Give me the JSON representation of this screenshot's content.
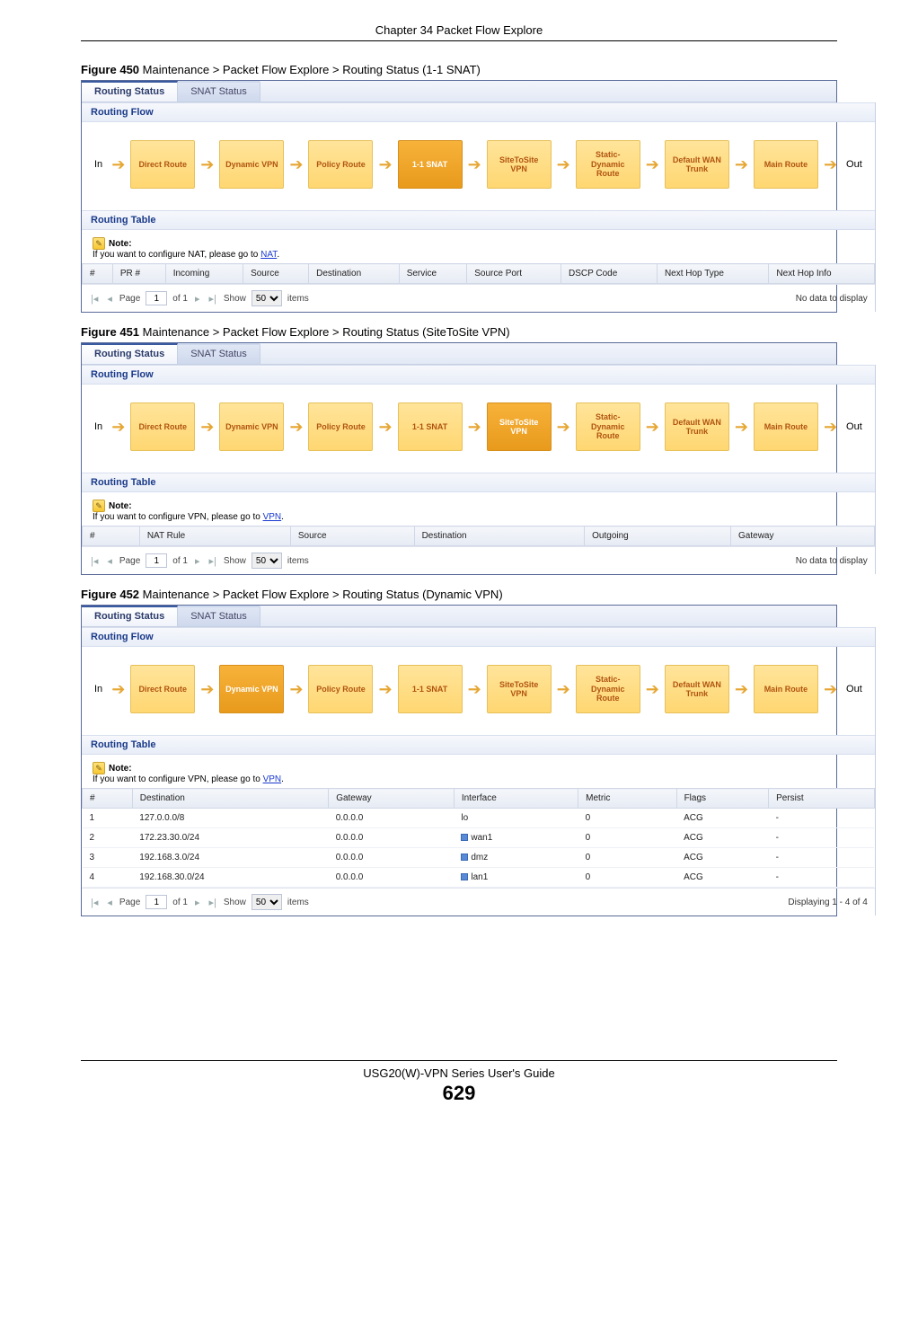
{
  "header": {
    "chapter": "Chapter 34 Packet Flow Explore"
  },
  "footer": {
    "guide": "USG20(W)-VPN Series User's Guide",
    "page": "629"
  },
  "common": {
    "tab_active": "Routing Status",
    "tab_inactive": "SNAT Status",
    "section_flow": "Routing Flow",
    "section_table": "Routing Table",
    "in": "In",
    "out": "Out",
    "note_label": "Note:",
    "pager_page": "Page",
    "pager_of": "of 1",
    "pager_show": "Show",
    "pager_items": "items",
    "pager_value": "1",
    "pager_size": "50",
    "no_data": "No data to display"
  },
  "flow_boxes": [
    "Direct Route",
    "Dynamic VPN",
    "Policy Route",
    "1-1 SNAT",
    "SiteToSite VPN",
    "Static-Dynamic Route",
    "Default WAN Trunk",
    "Main Route"
  ],
  "figures": [
    {
      "num": "Figure 450",
      "caption": "Maintenance > Packet Flow Explore > Routing Status (1-1 SNAT)",
      "active_idx": 3,
      "note_text": "If you want to configure NAT, please go to ",
      "note_link": "NAT",
      "columns": [
        "#",
        "PR #",
        "Incoming",
        "Source",
        "Destination",
        "Service",
        "Source Port",
        "DSCP Code",
        "Next Hop Type",
        "Next Hop Info"
      ],
      "rows": [],
      "pager_right": "No data to display"
    },
    {
      "num": "Figure 451",
      "caption": "Maintenance > Packet Flow Explore > Routing Status (SiteToSite VPN)",
      "active_idx": 4,
      "note_text": "If you want to configure VPN, please go to ",
      "note_link": "VPN",
      "columns": [
        "#",
        "NAT Rule",
        "Source",
        "Destination",
        "Outgoing",
        "Gateway"
      ],
      "rows": [],
      "pager_right": "No data to display"
    },
    {
      "num": "Figure 452",
      "caption": "Maintenance > Packet Flow Explore > Routing Status (Dynamic VPN)",
      "active_idx": 1,
      "note_text": "If you want to configure VPN, please go to ",
      "note_link": "VPN",
      "columns": [
        "#",
        "Destination",
        "Gateway",
        "Interface",
        "Metric",
        "Flags",
        "Persist"
      ],
      "rows": [
        {
          "n": "1",
          "dest": "127.0.0.0/8",
          "gw": "0.0.0.0",
          "iface": "lo",
          "iface_icon": false,
          "metric": "0",
          "flags": "ACG",
          "persist": "-"
        },
        {
          "n": "2",
          "dest": "172.23.30.0/24",
          "gw": "0.0.0.0",
          "iface": "wan1",
          "iface_icon": true,
          "metric": "0",
          "flags": "ACG",
          "persist": "-"
        },
        {
          "n": "3",
          "dest": "192.168.3.0/24",
          "gw": "0.0.0.0",
          "iface": "dmz",
          "iface_icon": true,
          "metric": "0",
          "flags": "ACG",
          "persist": "-"
        },
        {
          "n": "4",
          "dest": "192.168.30.0/24",
          "gw": "0.0.0.0",
          "iface": "lan1",
          "iface_icon": true,
          "metric": "0",
          "flags": "ACG",
          "persist": "-"
        }
      ],
      "pager_right": "Displaying 1 - 4 of 4"
    }
  ]
}
